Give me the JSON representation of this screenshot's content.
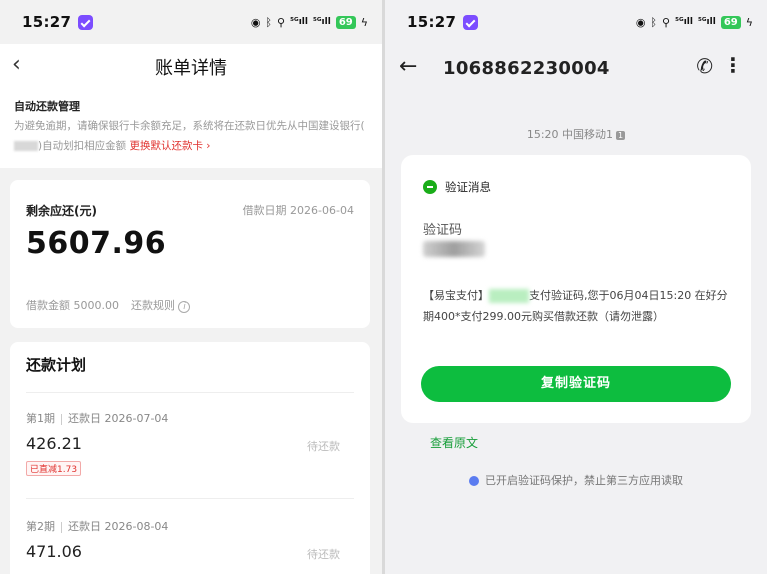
{
  "left": {
    "status": {
      "time": "15:27",
      "battery": "69"
    },
    "header": {
      "back_icon": "‹",
      "title": "账单详情"
    },
    "notice": {
      "title": "自动还款管理",
      "text_part1": "为避免逾期，请确保银行卡余额充足，系统将在还款日优先从中国建设银行(",
      "text_part2": ")自动划扣相应金额",
      "link": "更换默认还款卡"
    },
    "balance": {
      "label": "剩余应还(元)",
      "date": "借款日期 2026-06-04",
      "amount": "5607.96",
      "loan_amount": "借款金额 5000.00",
      "rules": "还款规则"
    },
    "plan": {
      "title": "还款计划",
      "periods": [
        {
          "period": "第1期",
          "due": "还款日 2026-07-04",
          "amount": "426.21",
          "status": "待还款",
          "tag": "已直减1.73"
        },
        {
          "period": "第2期",
          "due": "还款日 2026-08-04",
          "amount": "471.06",
          "status": "待还款",
          "tag": ""
        }
      ]
    }
  },
  "right": {
    "status": {
      "time": "15:27",
      "battery": "69"
    },
    "sender": "1068862230004",
    "timestamp": "15:20 中国移动1",
    "sim_badge": "1",
    "message": {
      "header": "验证消息",
      "code_label": "验证码",
      "body_part1": "【易宝支付】",
      "body_part2": "支付验证码,您于06月04日15:20 在好分期400*支付299.00元购买借款还款（请勿泄露）",
      "copy_button": "复制验证码"
    },
    "view_original": "查看原文",
    "protection": "已开启验证码保护，禁止第三方应用读取"
  },
  "colors": {
    "accent_red": "#e0322f",
    "accent_green": "#0dbd3f",
    "badge_purple": "#7c4dff"
  }
}
